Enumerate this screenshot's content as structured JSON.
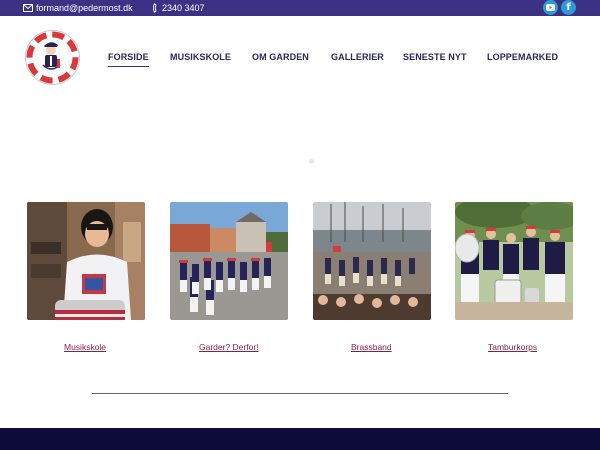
{
  "topbar": {
    "email": "formand@pedermost.dk",
    "phone": "2340 3407",
    "social": [
      {
        "icon": "youtube-icon"
      },
      {
        "icon": "facebook-icon",
        "glyph": "f"
      }
    ]
  },
  "nav": {
    "items": [
      {
        "label": "FORSIDE",
        "active": true
      },
      {
        "label": "MUSIKSKOLE"
      },
      {
        "label": "OM GARDEN"
      },
      {
        "label": "GALLERIER"
      },
      {
        "label": "SENESTE NYT"
      },
      {
        "label": "LOPPEMARKED"
      }
    ]
  },
  "cards": [
    {
      "label": "Musikskole"
    },
    {
      "label": "Garder? Derfor!"
    },
    {
      "label": "Brassband"
    },
    {
      "label": "Tamburkorps"
    }
  ],
  "colors": {
    "topbar": "#3b3284",
    "nav_text": "#2b2560",
    "link": "#8b1e45",
    "divider": "#6d5da8",
    "footer": "#0d0b3a"
  }
}
